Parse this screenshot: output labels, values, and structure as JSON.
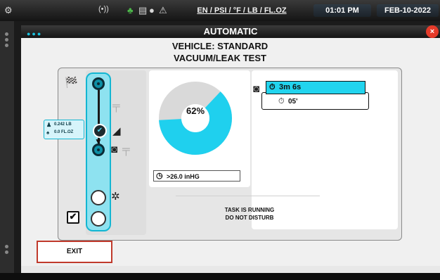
{
  "status_bar": {
    "wireless_icon": "(•))",
    "units": "EN / PSI / °F / LB / FL.OZ",
    "time": "01:01 PM",
    "date": "FEB-10-2022"
  },
  "window": {
    "title": "AUTOMATIC",
    "close_glyph": "×"
  },
  "header": {
    "vehicle": "VEHICLE: STANDARD",
    "test": "VACUUM/LEAK TEST"
  },
  "sequence": {
    "badge_line1": "0.242 LB",
    "badge_line2": "0.0 FL.OZ",
    "checkbox_glyph": "✔"
  },
  "gauge": {
    "percent_label": "62%",
    "percent_value": 62,
    "fill_color": "#1fd0ee",
    "track_color": "#d9d9d9",
    "pressure": ">26.0 inHG"
  },
  "timers": {
    "main": "3m 6s",
    "sub": "05'"
  },
  "status_message": {
    "line1": "TASK IS RUNNING",
    "line2": "DO NOT DISTURB"
  },
  "footer": {
    "exit_label": "EXIT"
  },
  "colors": {
    "accent": "#13b6d2",
    "close": "#e53b2a",
    "exit_border": "#c0392b"
  }
}
